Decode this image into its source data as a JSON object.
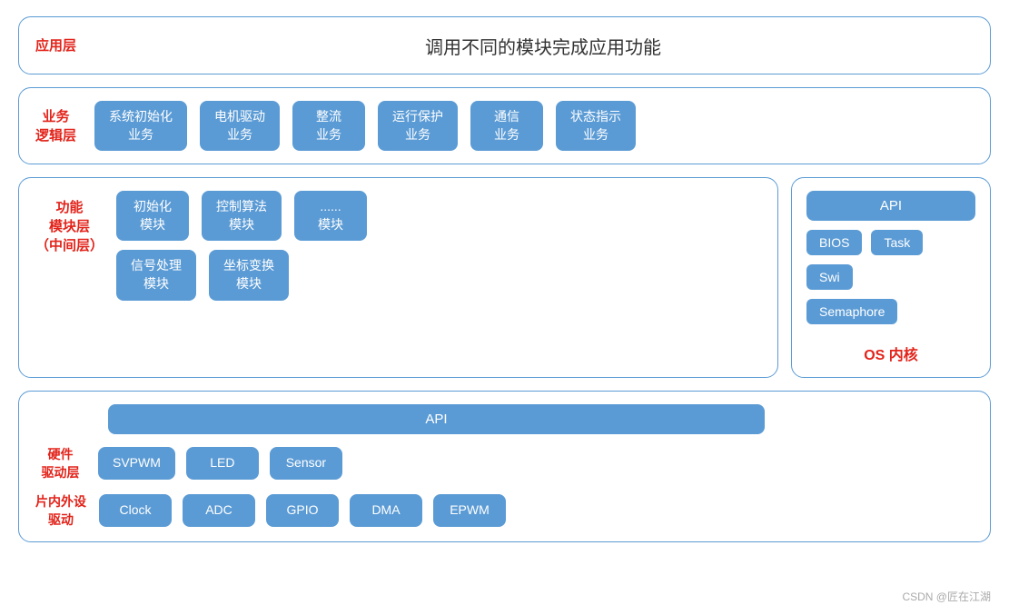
{
  "app_layer": {
    "label": "应用层",
    "text": "调用不同的模块完成应用功能"
  },
  "biz_layer": {
    "label": "业务\n逻辑层",
    "modules": [
      "系统初始化\n业务",
      "电机驱动\n业务",
      "整流\n业务",
      "运行保护\n业务",
      "通信\n业务",
      "状态指示\n业务"
    ]
  },
  "func_layer": {
    "label": "功能\n模块层\n（中间层）",
    "row1": [
      "初始化\n模块",
      "控制算法\n模块",
      "......\n模块"
    ],
    "row2": [
      "信号处理\n模块",
      "坐标变换\n模块"
    ]
  },
  "hw_layer": {
    "api_label": "API",
    "hw_label": "硬件\n驱动层",
    "hw_modules": [
      "SVPWM",
      "LED",
      "Sensor"
    ],
    "chip_label": "片内外设\n驱动",
    "chip_modules": [
      "Clock",
      "ADC",
      "GPIO",
      "DMA",
      "EPWM"
    ]
  },
  "os_box": {
    "api_label": "API",
    "bios_label": "BIOS",
    "task_label": "Task",
    "swi_label": "Swi",
    "semaphore_label": "Semaphore",
    "os_label": "OS\n内核"
  },
  "watermark": "CSDN @匠在江湖"
}
